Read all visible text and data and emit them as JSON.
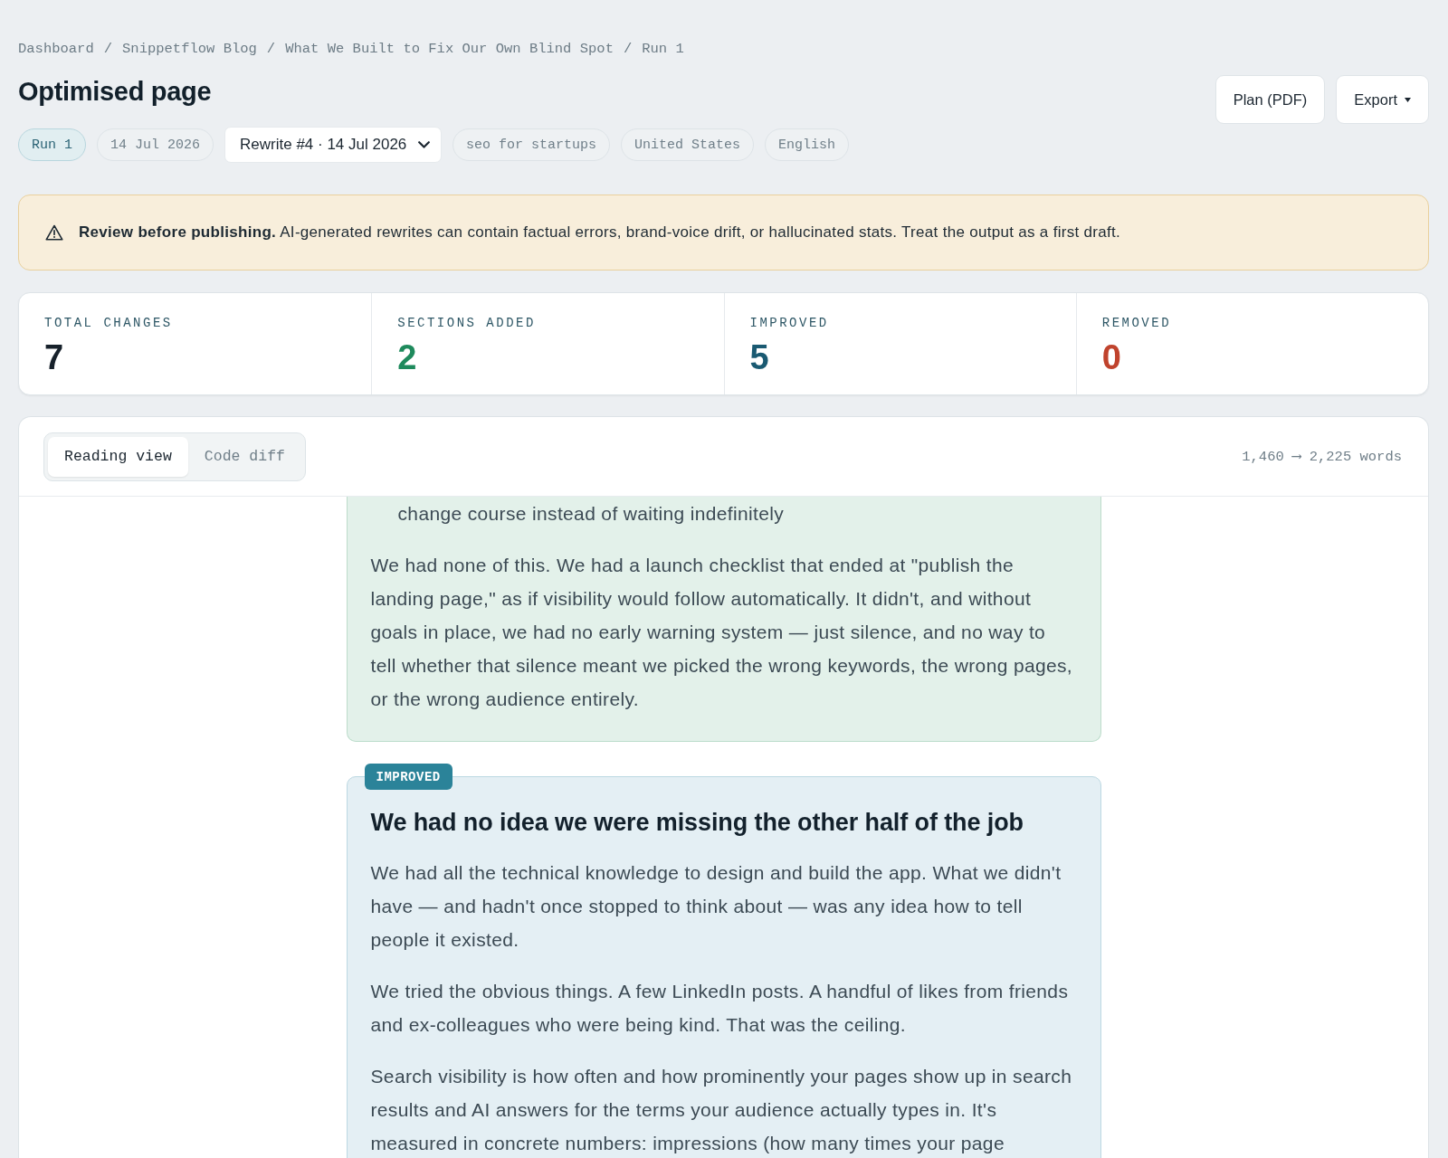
{
  "breadcrumb": [
    {
      "text": "Dashboard",
      "separator": "/"
    },
    {
      "text": "Snippetflow Blog",
      "separator": "/"
    },
    {
      "text": "What We Built to Fix Our Own Blind Spot",
      "separator": "/"
    },
    {
      "text": "Run 1"
    }
  ],
  "header": {
    "title": "Optimised page",
    "actions": [
      {
        "kind": "plain",
        "label": "Plan (PDF)"
      },
      {
        "kind": "dropdown",
        "label": "Export"
      }
    ]
  },
  "meta": [
    {
      "kind": "run",
      "text": "Run 1"
    },
    {
      "kind": "chip",
      "text": "14 Jul 2026"
    },
    {
      "kind": "select",
      "value": "Rewrite #4 · 14 Jul 2026"
    },
    {
      "kind": "chip",
      "text": "seo for startups"
    },
    {
      "kind": "chip",
      "text": "United States"
    },
    {
      "kind": "chip",
      "text": "English"
    }
  ],
  "warning": {
    "text": "**Review before publishing.** AI-generated rewrites can contain factual errors, brand-voice drift, or hallucinated stats. Treat the output as a first draft."
  },
  "stats": [
    {
      "label": "TOTAL CHANGES",
      "value": "7",
      "color": "#17212b"
    },
    {
      "label": "SECTIONS ADDED",
      "value": "2",
      "color": "#1e8a5c"
    },
    {
      "label": "IMPROVED",
      "value": "5",
      "color": "#1a5a72"
    },
    {
      "label": "REMOVED",
      "value": "0",
      "color": "#c0432d"
    }
  ],
  "viewer": {
    "tabs": [
      {
        "label": "Reading view",
        "selected": true
      },
      {
        "label": "Code diff",
        "selected": false
      }
    ],
    "word_count": "1,460 ⟶ 2,225 words",
    "blocks": [
      {
        "kind": "added",
        "paragraphs": [
          {
            "kind": "list_item",
            "text": "change course instead of waiting indefinitely"
          },
          {
            "kind": "paragraph",
            "text": "We had none of this. We had a launch checklist that ended at \"publish the landing page,\" as if visibility would follow automatically. It didn't, and without goals in place, we had no early warning system — just silence, and no way to tell whether that silence meant we picked the wrong keywords, the wrong pages, or the wrong audience entirely."
          }
        ]
      },
      {
        "kind": "improved",
        "badge": "IMPROVED",
        "heading": "We had no idea we were missing the other half of the job",
        "paragraphs": [
          {
            "kind": "paragraph",
            "text": "We had all the technical knowledge to design and build the app. What we didn't have — and hadn't once stopped to think about — was any idea how to tell people it existed."
          },
          {
            "kind": "paragraph",
            "text": "We tried the obvious things. A few LinkedIn posts. A handful of likes from friends and ex-colleagues who were being kind. That was the ceiling."
          },
          {
            "kind": "paragraph",
            "text": "Search visibility is how often and how prominently your pages show up in search results and AI answers for the terms your audience actually types in. It's measured in concrete numbers: impressions (how many times your page"
          }
        ]
      }
    ]
  }
}
